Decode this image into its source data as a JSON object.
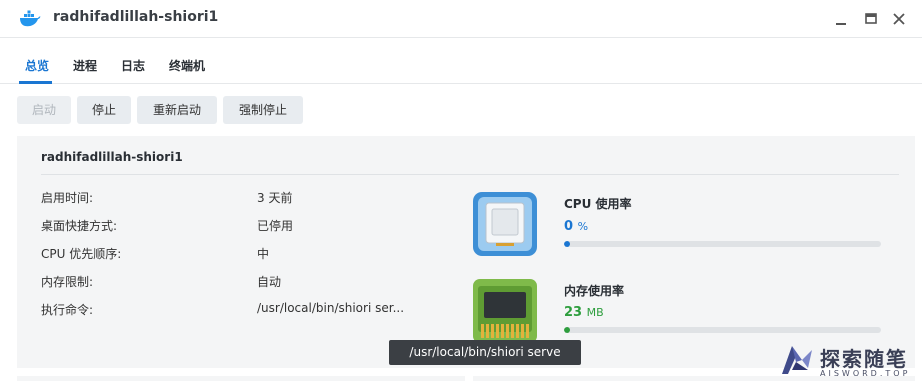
{
  "window": {
    "title": "radhifadlillah-shiori1",
    "icon": "docker-whale-icon",
    "controls": [
      "minimize-icon",
      "maximize-icon",
      "close-icon"
    ]
  },
  "tabs": [
    {
      "label": "总览",
      "active": true
    },
    {
      "label": "进程",
      "active": false
    },
    {
      "label": "日志",
      "active": false
    },
    {
      "label": "终端机",
      "active": false
    }
  ],
  "toolbar": {
    "start_label": "启动",
    "start_disabled": true,
    "stop_label": "停止",
    "restart_label": "重新启动",
    "force_stop_label": "强制停止"
  },
  "details": {
    "title": "radhifadlillah-shiori1",
    "rows": [
      {
        "label": "启用时间:",
        "value": "3 天前"
      },
      {
        "label": "桌面快捷方式:",
        "value": "已停用"
      },
      {
        "label": "CPU 优先顺序:",
        "value": "中"
      },
      {
        "label": "内存限制:",
        "value": "自动"
      },
      {
        "label": "执行命令:",
        "value": "/usr/local/bin/shiori ser..."
      }
    ]
  },
  "metrics": {
    "cpu": {
      "title": "CPU 使用率",
      "value": "0",
      "unit": "%",
      "fraction": 0.02,
      "color": "#1a76d2"
    },
    "memory": {
      "title": "内存使用率",
      "value": "23",
      "unit": "MB",
      "fraction": 0.02,
      "color": "#2e9e3e"
    }
  },
  "tooltip": {
    "text": "/usr/local/bin/shiori serve"
  },
  "watermark": {
    "title": "探索随笔",
    "subtitle": "AISWORD.TOP"
  }
}
